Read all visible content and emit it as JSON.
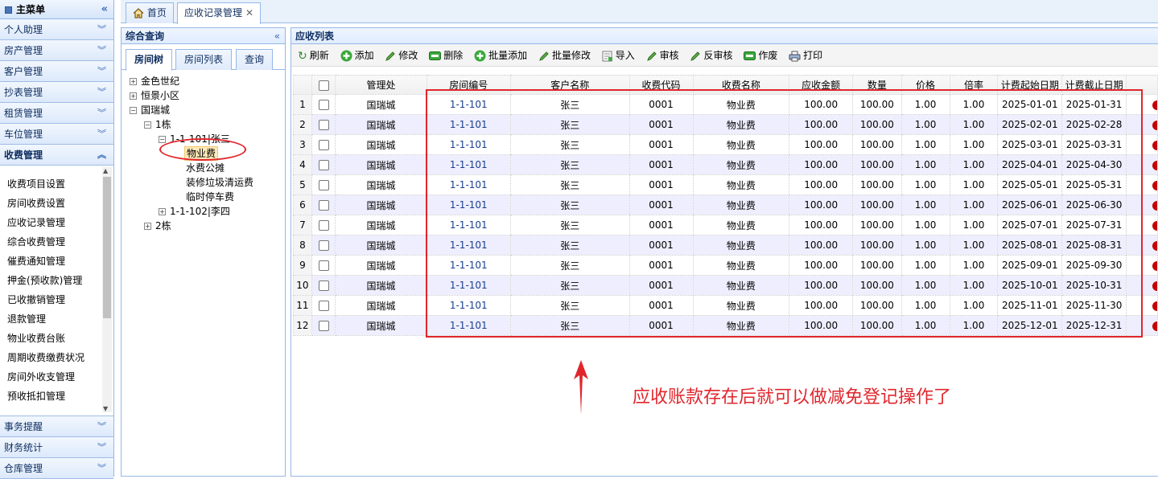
{
  "left_menu": {
    "title": "主菜单",
    "items_top": [
      "个人助理",
      "房产管理",
      "客户管理",
      "抄表管理",
      "租赁管理",
      "车位管理"
    ],
    "active_group": "收费管理",
    "submenu": [
      "收费项目设置",
      "房间收费设置",
      "应收记录管理",
      "综合收费管理",
      "催费通知管理",
      "押金(预收款)管理",
      "已收撤销管理",
      "退款管理",
      "物业收费台账",
      "周期收费缴费状况",
      "房间外收支管理",
      "预收抵扣管理"
    ],
    "items_bottom": [
      "事务提醒",
      "财务统计",
      "仓库管理"
    ]
  },
  "tabs": {
    "home": "首页",
    "current": "应收记录管理"
  },
  "query": {
    "title": "综合查询",
    "tabs": [
      "房间树",
      "房间列表",
      "查询"
    ],
    "tree": {
      "n1": "金色世纪",
      "n2": "恒景小区",
      "n3": "国瑞城",
      "n4": "1栋",
      "n5": "1-1-101|张三",
      "n6": "物业费",
      "n7": "水费公摊",
      "n8": "装修垃圾清运费",
      "n9": "临时停车费",
      "n10": "1-1-102|李四",
      "n11": "2栋"
    }
  },
  "grid": {
    "title": "应收列表",
    "toolbar": [
      "刷新",
      "添加",
      "修改",
      "删除",
      "批量添加",
      "批量修改",
      "导入",
      "审核",
      "反审核",
      "作废",
      "打印"
    ],
    "columns": [
      "管理处",
      "房间编号",
      "客户名称",
      "收费代码",
      "收费名称",
      "应收金额",
      "数量",
      "价格",
      "倍率",
      "计费起始日期",
      "计费截止日期"
    ],
    "rows": [
      [
        "1",
        "国瑞城",
        "1-1-101",
        "张三",
        "0001",
        "物业费",
        "100.00",
        "100.00",
        "1.00",
        "1.00",
        "2025-01-01",
        "2025-01-31"
      ],
      [
        "2",
        "国瑞城",
        "1-1-101",
        "张三",
        "0001",
        "物业费",
        "100.00",
        "100.00",
        "1.00",
        "1.00",
        "2025-02-01",
        "2025-02-28"
      ],
      [
        "3",
        "国瑞城",
        "1-1-101",
        "张三",
        "0001",
        "物业费",
        "100.00",
        "100.00",
        "1.00",
        "1.00",
        "2025-03-01",
        "2025-03-31"
      ],
      [
        "4",
        "国瑞城",
        "1-1-101",
        "张三",
        "0001",
        "物业费",
        "100.00",
        "100.00",
        "1.00",
        "1.00",
        "2025-04-01",
        "2025-04-30"
      ],
      [
        "5",
        "国瑞城",
        "1-1-101",
        "张三",
        "0001",
        "物业费",
        "100.00",
        "100.00",
        "1.00",
        "1.00",
        "2025-05-01",
        "2025-05-31"
      ],
      [
        "6",
        "国瑞城",
        "1-1-101",
        "张三",
        "0001",
        "物业费",
        "100.00",
        "100.00",
        "1.00",
        "1.00",
        "2025-06-01",
        "2025-06-30"
      ],
      [
        "7",
        "国瑞城",
        "1-1-101",
        "张三",
        "0001",
        "物业费",
        "100.00",
        "100.00",
        "1.00",
        "1.00",
        "2025-07-01",
        "2025-07-31"
      ],
      [
        "8",
        "国瑞城",
        "1-1-101",
        "张三",
        "0001",
        "物业费",
        "100.00",
        "100.00",
        "1.00",
        "1.00",
        "2025-08-01",
        "2025-08-31"
      ],
      [
        "9",
        "国瑞城",
        "1-1-101",
        "张三",
        "0001",
        "物业费",
        "100.00",
        "100.00",
        "1.00",
        "1.00",
        "2025-09-01",
        "2025-09-30"
      ],
      [
        "10",
        "国瑞城",
        "1-1-101",
        "张三",
        "0001",
        "物业费",
        "100.00",
        "100.00",
        "1.00",
        "1.00",
        "2025-10-01",
        "2025-10-31"
      ],
      [
        "11",
        "国瑞城",
        "1-1-101",
        "张三",
        "0001",
        "物业费",
        "100.00",
        "100.00",
        "1.00",
        "1.00",
        "2025-11-01",
        "2025-11-30"
      ],
      [
        "12",
        "国瑞城",
        "1-1-101",
        "张三",
        "0001",
        "物业费",
        "100.00",
        "100.00",
        "1.00",
        "1.00",
        "2025-12-01",
        "2025-12-31"
      ]
    ]
  },
  "annotation": {
    "note": "应收账款存在后就可以做减免登记操作了",
    "color": "#e0262c"
  }
}
